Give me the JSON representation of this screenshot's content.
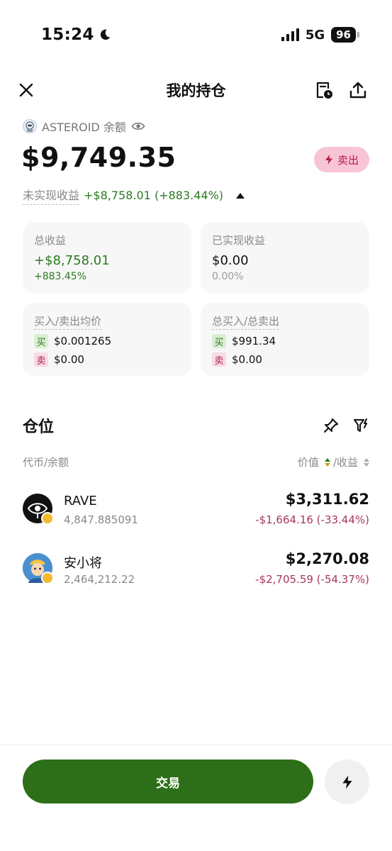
{
  "status": {
    "time": "15:24",
    "network": "5G",
    "battery": "96"
  },
  "header": {
    "title": "我的持仓"
  },
  "account": {
    "name": "ASTEROID 余额",
    "balance": "$9,749.35",
    "sell_label": "卖出"
  },
  "unrealized": {
    "label": "未实现收益",
    "value": "+$8,758.01 (+883.44%)"
  },
  "cards": {
    "total": {
      "title": "总收益",
      "value": "+$8,758.01",
      "pct": "+883.45%"
    },
    "realized": {
      "title": "已实现收益",
      "value": "$0.00",
      "pct": "0.00%"
    },
    "avg": {
      "title": "买入/卖出均价",
      "buy_tag": "买",
      "buy": "$0.001265",
      "sell_tag": "卖",
      "sell": "$0.00"
    },
    "sum": {
      "title": "总买入/总卖出",
      "buy_tag": "买",
      "buy": "$991.34",
      "sell_tag": "卖",
      "sell": "$0.00"
    }
  },
  "positions": {
    "title": "仓位",
    "col_left": "代币/余额",
    "col_value": "价值",
    "col_pnl": "/收益",
    "items": [
      {
        "name": "RAVE",
        "amount": "4,847.885091",
        "value": "$3,311.62",
        "pnl": "-$1,664.16 (-33.44%)"
      },
      {
        "name": "安小将",
        "amount": "2,464,212.22",
        "value": "$2,270.08",
        "pnl": "-$2,705.59 (-54.37%)"
      }
    ]
  },
  "footer": {
    "trade_label": "交易"
  },
  "colors": {
    "green": "#2c7a21",
    "red": "#a8375a",
    "accent": "#2d6e18",
    "sell_bg": "#f8c5d5"
  }
}
